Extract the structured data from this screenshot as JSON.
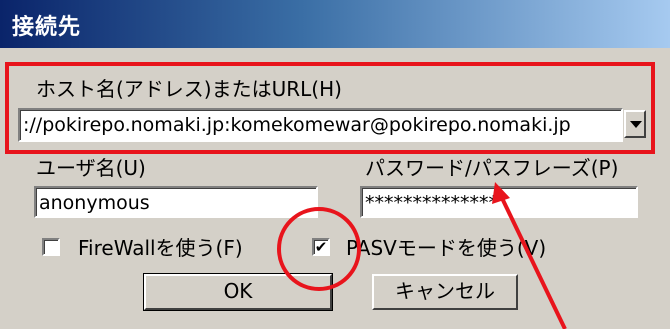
{
  "window": {
    "title": "接続先"
  },
  "host": {
    "label": "ホスト名(アドレス)またはURL(H)",
    "value": "://pokirepo.nomaki.jp:komekomewar@pokirepo.nomaki.jp"
  },
  "user": {
    "label": "ユーザ名(U)",
    "value": "anonymous"
  },
  "password": {
    "label": "パスワード/パスフレーズ(P)",
    "value": "**************"
  },
  "firewall": {
    "label": "FireWallを使う(F)",
    "checked": false
  },
  "pasv": {
    "label": "PASVモードを使う(V)",
    "checked": true,
    "mark": "✔"
  },
  "buttons": {
    "ok": "OK",
    "cancel": "キャンセル"
  },
  "annotations": {
    "highlight_color": "#e8141c"
  }
}
